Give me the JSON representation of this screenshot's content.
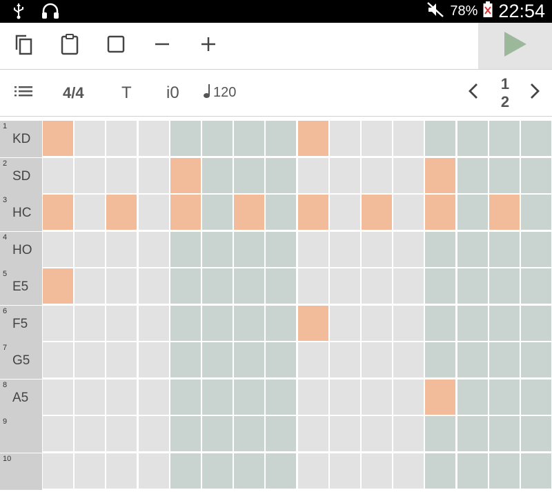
{
  "status_bar": {
    "left_icons": [
      "usb-icon",
      "headphones-icon"
    ],
    "right_icons": [
      "mute-icon",
      "battery-icon"
    ],
    "battery_percent": "78%",
    "time": "22:54"
  },
  "toolbar": {
    "buttons": [
      "copy-icon",
      "paste-icon",
      "select-icon",
      "remove-icon",
      "add-icon",
      "play-icon"
    ],
    "play_color": "#9cb89a"
  },
  "controls": {
    "time_signature": "4/4",
    "transpose_label": "T",
    "instrument_label": "i0",
    "tempo": "120",
    "page_current": "1",
    "page_total": "2"
  },
  "colors": {
    "active": "#f2bb9a",
    "light": "#e2e2e2",
    "dark": "#c9d3cf",
    "label_bg": "#cfcfcf"
  },
  "grid": {
    "rows": [
      {
        "num": "1",
        "name": "KD",
        "active": [
          0,
          8
        ]
      },
      {
        "num": "2",
        "name": "SD",
        "active": [
          4,
          12
        ]
      },
      {
        "num": "3",
        "name": "HC",
        "active": [
          0,
          2,
          4,
          6,
          8,
          10,
          12,
          14
        ]
      },
      {
        "num": "4",
        "name": "HO",
        "active": []
      },
      {
        "num": "5",
        "name": "E5",
        "active": [
          0
        ]
      },
      {
        "num": "6",
        "name": "F5",
        "active": [
          8
        ]
      },
      {
        "num": "7",
        "name": "G5",
        "active": []
      },
      {
        "num": "8",
        "name": "A5",
        "active": [
          12
        ]
      },
      {
        "num": "9",
        "name": "",
        "active": []
      },
      {
        "num": "10",
        "name": "",
        "active": []
      }
    ],
    "steps": 16,
    "dark_groups": [
      1,
      3
    ]
  }
}
